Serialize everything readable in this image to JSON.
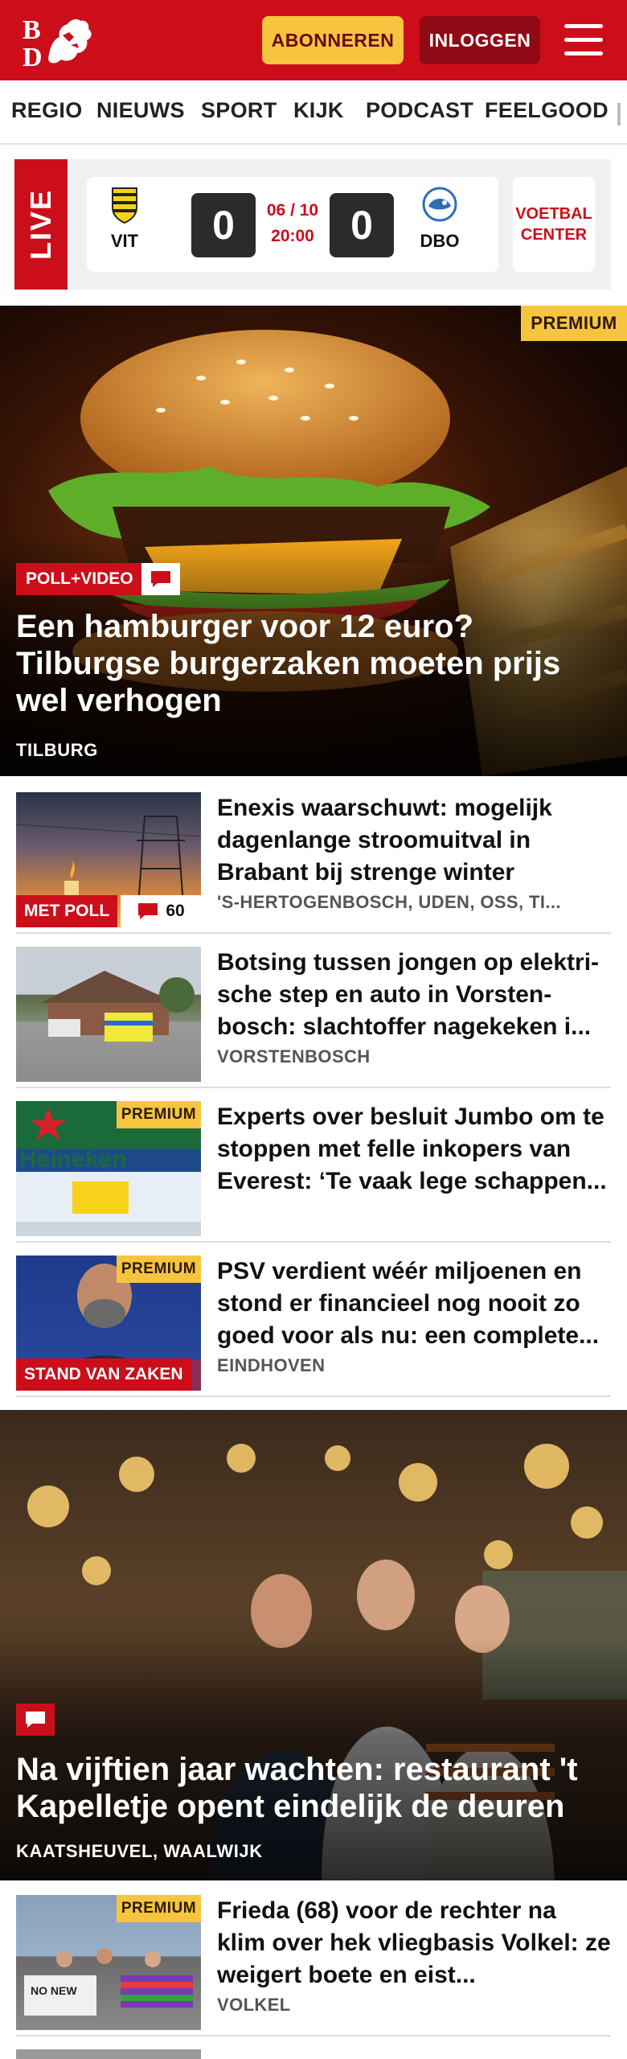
{
  "header": {
    "logo_text": "BD",
    "subscribe_label": "ABONNEREN",
    "login_label": "INLOGGEN",
    "menu_icon": "hamburger-menu-icon",
    "brand_color": "#cc0e1a"
  },
  "nav": {
    "items": [
      "REGIO",
      "NIEUWS",
      "SPORT",
      "KIJK",
      "PODCAST",
      "FEELGOOD"
    ]
  },
  "live": {
    "label": "LIVE",
    "home_team": "VIT",
    "away_team": "DBO",
    "home_score": "0",
    "away_score": "0",
    "date": "06 / 10",
    "time": "20:00",
    "voetbal_center": "VOETBAL CENTER"
  },
  "hero": {
    "premium": "PREMIUM",
    "label": "POLL+VIDEO",
    "title": "Een hamburger voor 12 euro? Tilburgse burgerzaken moeten prijs wel verhogen",
    "location": "TILBURG"
  },
  "articles": [
    {
      "title": "Enexis waarschuwt: mogelijk dagenlange stroomuitval in Brabant bij strenge winter",
      "location": "'S-HERTOGENBOSCH, UDEN, OSS, TI...",
      "badge": "MET POLL",
      "comments": "60"
    },
    {
      "title": "Botsing tussen jongen op elektri-sche step en auto in Vorsten-bosch: slachtoffer nagekeken i...",
      "location": "VORSTENBOSCH"
    },
    {
      "title": "Experts over besluit Jumbo om te stoppen met felle inkopers van Everest: ‘Te vaak lege schappen...",
      "premium": "PREMIUM"
    },
    {
      "title": "PSV verdient wéér miljoenen en stond er financieel nog nooit zo goed voor als nu: een complete...",
      "location": "EINDHOVEN",
      "premium": "PREMIUM",
      "badge": "STAND VAN ZAKEN"
    }
  ],
  "hero2": {
    "title": "Na vijftien jaar wachten: restaurant 't Kapelletje opent eindelijk de deuren",
    "location": "KAATSHEUVEL, WAALWIJK"
  },
  "article_last": {
    "title": "Frieda (68) voor de rechter na klim over hek vliegbasis Volkel: ze weigert boete en eist...",
    "location": "VOLKEL",
    "premium": "PREMIUM"
  }
}
